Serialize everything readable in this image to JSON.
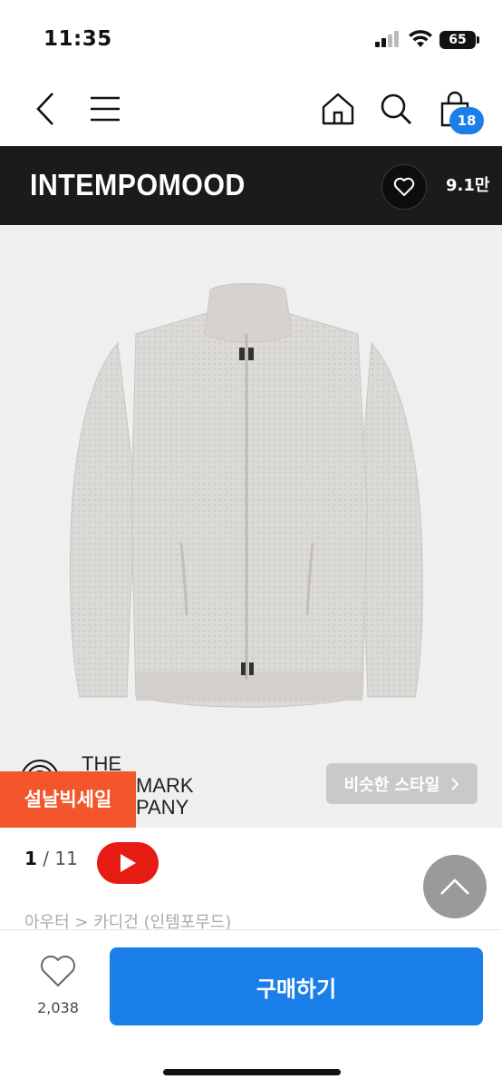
{
  "status_bar": {
    "time": "11:35",
    "battery": "65"
  },
  "nav": {
    "cart_count": "18"
  },
  "brand": {
    "name": "INTEMPOMOOD",
    "like_count": "9.1만"
  },
  "product": {
    "watermark_line1": "THE",
    "watermark_line2": "MARK",
    "watermark_line3": "PANY",
    "sale_tag": "설날빅세일",
    "similar_style_label": "비슷한 스타일"
  },
  "pager": {
    "current": "1",
    "separator": " / ",
    "total": "11"
  },
  "breadcrumb": "아우터 > 카디건 (인템포무드)",
  "bottom": {
    "wish_count": "2,038",
    "buy_label": "구매하기"
  },
  "colors": {
    "accent": "#1a7fe8",
    "sale": "#f2562a",
    "brand_bar": "#1b1b1b",
    "youtube": "#e51b14"
  }
}
